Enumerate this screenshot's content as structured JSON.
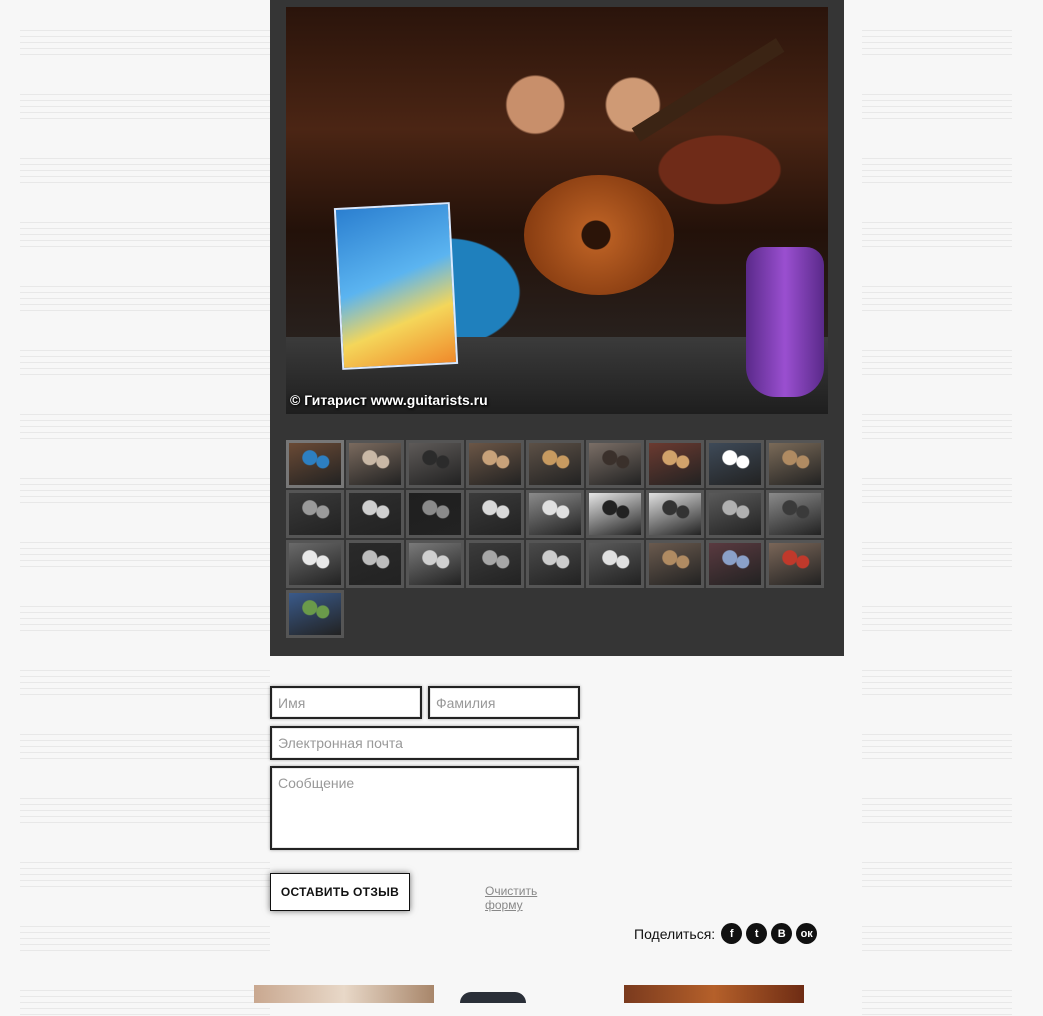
{
  "gallery": {
    "main_photo_caption": "© Гитарист www.guitarists.ru",
    "thumbnails": [
      {
        "tone": "#6a4a35",
        "accent": "#2d7fc1",
        "active": true
      },
      {
        "tone": "#7a6a5e",
        "accent": "#c9b8a6"
      },
      {
        "tone": "#5e5a58",
        "accent": "#2b2b2b"
      },
      {
        "tone": "#6b5646",
        "accent": "#c8a27a"
      },
      {
        "tone": "#5c5046",
        "accent": "#c79a60"
      },
      {
        "tone": "#7a6e66",
        "accent": "#3a302b"
      },
      {
        "tone": "#6b3a30",
        "accent": "#d1a26b"
      },
      {
        "tone": "#3e4a58",
        "accent": "#ffffff"
      },
      {
        "tone": "#7a6a58",
        "accent": "#b08b62"
      },
      {
        "tone": "#3a3a3a",
        "accent": "#9a9a9a"
      },
      {
        "tone": "#2e2e2e",
        "accent": "#cfcfcf"
      },
      {
        "tone": "#1f1f1f",
        "accent": "#8a8a8a"
      },
      {
        "tone": "#3a3a3a",
        "accent": "#d9d9d9"
      },
      {
        "tone": "#8a8a8a",
        "accent": "#e0e0e0"
      },
      {
        "tone": "#e6e6e6",
        "accent": "#222222"
      },
      {
        "tone": "#e0e0e0",
        "accent": "#333333"
      },
      {
        "tone": "#5a5a5a",
        "accent": "#b0b0b0"
      },
      {
        "tone": "#8a8a8a",
        "accent": "#3a3a3a"
      },
      {
        "tone": "#6a6a6a",
        "accent": "#e8e8e8"
      },
      {
        "tone": "#2a2a2a",
        "accent": "#bdbdbd"
      },
      {
        "tone": "#7a7a7a",
        "accent": "#d0d0d0"
      },
      {
        "tone": "#3b3b3b",
        "accent": "#a7a7a7"
      },
      {
        "tone": "#4a4a4a",
        "accent": "#cccccc"
      },
      {
        "tone": "#5a5a5a",
        "accent": "#e0e0e0"
      },
      {
        "tone": "#6a5a4e",
        "accent": "#b08b62"
      },
      {
        "tone": "#5a3a40",
        "accent": "#8aa0c8"
      },
      {
        "tone": "#7a6658",
        "accent": "#c0392b"
      },
      {
        "tone": "#3a5a8a",
        "accent": "#6a9a4a"
      }
    ]
  },
  "form": {
    "first_name_placeholder": "Имя",
    "last_name_placeholder": "Фамилия",
    "email_placeholder": "Электронная почта",
    "message_placeholder": "Сообщение",
    "submit_label": "ОСТАВИТЬ ОТЗЫВ",
    "clear_label": "Очистить форму"
  },
  "share": {
    "label": "Поделиться:",
    "networks": [
      {
        "id": "facebook",
        "glyph": "f"
      },
      {
        "id": "twitter",
        "glyph": "t"
      },
      {
        "id": "vkontakte",
        "glyph": "В"
      },
      {
        "id": "odnoklassniki",
        "glyph": "ок"
      }
    ]
  },
  "colors": {
    "gallery_bg": "#353535",
    "page_bg": "#f7f7f7",
    "thumb_border": "#555555"
  }
}
